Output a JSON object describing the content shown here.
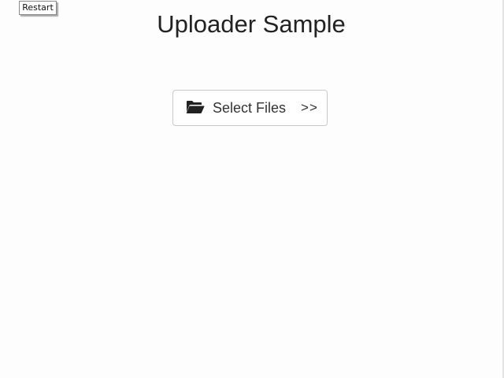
{
  "toolbar": {
    "restart_label": "Restart"
  },
  "header": {
    "title": "Uploader Sample"
  },
  "uploader": {
    "select_label": "Select Files",
    "arrow_label": ">>",
    "icon": "folder-open-icon"
  },
  "colors": {
    "background": "#fdfdfd",
    "title_text": "#222222",
    "button_border": "#c9c9c9",
    "icon_fill": "#222222"
  }
}
